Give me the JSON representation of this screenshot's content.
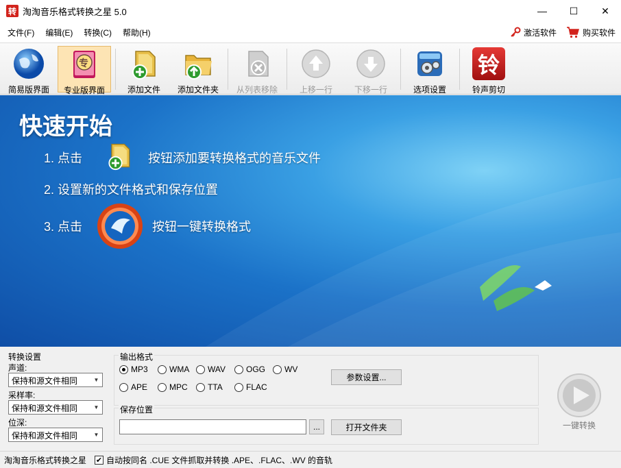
{
  "window": {
    "title": "淘淘音乐格式转换之星 5.0",
    "app_icon_char": "转",
    "controls": {
      "minimize": "—",
      "maximize": "☐",
      "close": "✕"
    }
  },
  "menu": {
    "items": [
      "文件(F)",
      "编辑(E)",
      "转换(C)",
      "帮助(H)"
    ],
    "activate_label": "激活软件",
    "buy_label": "购买软件"
  },
  "toolbar": {
    "buttons": [
      {
        "label": "简易版界面",
        "icon": "globe-icon",
        "enabled": true,
        "active": false
      },
      {
        "label": "专业版界面",
        "icon": "book-icon",
        "enabled": true,
        "active": true
      },
      {
        "label": "添加文件",
        "icon": "add-file-icon",
        "enabled": true,
        "active": false
      },
      {
        "label": "添加文件夹",
        "icon": "add-folder-icon",
        "enabled": true,
        "active": false
      },
      {
        "label": "从列表移除",
        "icon": "remove-icon",
        "enabled": false,
        "active": false
      },
      {
        "label": "上移一行",
        "icon": "move-up-icon",
        "enabled": false,
        "active": false
      },
      {
        "label": "下移一行",
        "icon": "move-down-icon",
        "enabled": false,
        "active": false
      },
      {
        "label": "选项设置",
        "icon": "settings-icon",
        "enabled": true,
        "active": false
      },
      {
        "label": "铃声剪切",
        "icon": "ringtone-icon",
        "enabled": true,
        "active": false
      }
    ],
    "book_icon_char": "专",
    "ringtone_icon_char": "铃"
  },
  "banner": {
    "title": "快速开始",
    "step1_prefix": "1. 点击",
    "step1_suffix": "按钮添加要转换格式的音乐文件",
    "step2": "2. 设置新的文件格式和保存位置",
    "step3_prefix": "3. 点击",
    "step3_suffix": "按钮一键转换格式"
  },
  "settings": {
    "section_label": "转换设置",
    "channel_label": "声道:",
    "channel_value": "保持和源文件相同",
    "samplerate_label": "采样率:",
    "samplerate_value": "保持和源文件相同",
    "bitdepth_label": "位深:",
    "bitdepth_value": "保持和源文件相同",
    "output_format_label": "输出格式",
    "formats": [
      "MP3",
      "WMA",
      "WAV",
      "OGG",
      "WV",
      "APE",
      "MPC",
      "TTA",
      "FLAC"
    ],
    "selected_format": "MP3",
    "params_button": "参数设置...",
    "save_location_label": "保存位置",
    "save_path": "",
    "browse_button": "...",
    "open_folder_button": "打开文件夹",
    "convert_button": "一键转换"
  },
  "status": {
    "app_name": "淘淘音乐格式转换之星",
    "auto_cue_checked": true,
    "auto_cue_label": "自动按同名 .CUE 文件抓取并转换 .APE、.FLAC、.WV 的音轨"
  },
  "colors": {
    "accent_red": "#d2231c",
    "banner_blue": "#1b72c8",
    "active_tab": "#fde4b4"
  }
}
